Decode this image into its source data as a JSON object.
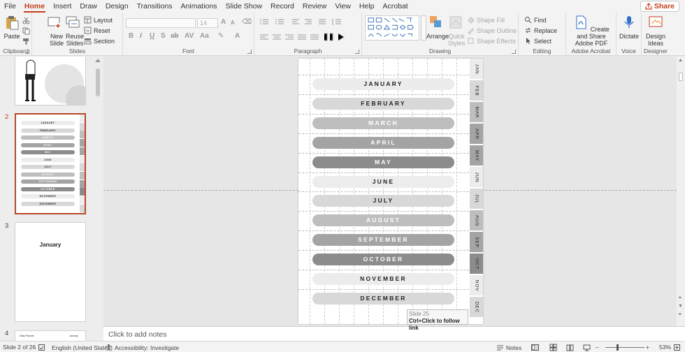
{
  "menu": {
    "tabs": [
      "File",
      "Home",
      "Insert",
      "Draw",
      "Design",
      "Transitions",
      "Animations",
      "Slide Show",
      "Record",
      "Review",
      "View",
      "Help",
      "Acrobat"
    ],
    "active_index": 1,
    "share_label": "Share"
  },
  "ribbon": {
    "clipboard": {
      "label": "Clipboard",
      "paste": "Paste"
    },
    "slides": {
      "label": "Slides",
      "new_slide": "New Slide",
      "reuse_slides": "Reuse Slides",
      "layout": "Layout",
      "reset": "Reset",
      "section": "Section"
    },
    "font": {
      "label": "Font",
      "size": "14"
    },
    "paragraph": {
      "label": "Paragraph"
    },
    "drawing": {
      "label": "Drawing",
      "arrange": "Arrange",
      "quick_styles": "Quick Styles",
      "shape_fill": "Shape Fill",
      "shape_outline": "Shape Outline",
      "shape_effects": "Shape Effects"
    },
    "editing": {
      "label": "Editing",
      "find": "Find",
      "replace": "Replace",
      "select": "Select"
    },
    "acrobat": {
      "label": "Adobe Acrobat",
      "create_share": "Create and Share Adobe PDF"
    },
    "voice": {
      "label": "Voice",
      "dictate": "Dictate"
    },
    "designer": {
      "label": "Designer",
      "design_ideas": "Design Ideas"
    }
  },
  "thumbnails": {
    "slide2_number": "2",
    "slide3_number": "3",
    "slide3_title": "January",
    "slide4_number": "4",
    "slide4_title": "Daily Planner",
    "slide4_right": "January"
  },
  "slide": {
    "months": [
      "JANUARY",
      "FEBRUARY",
      "MARCH",
      "APRIL",
      "MAY",
      "JUNE",
      "JULY",
      "AUGUST",
      "SEPTEMBER",
      "OCTOBER",
      "NOVEMBER",
      "DECEMBER"
    ],
    "tabs": [
      "JAN",
      "FEB",
      "MAR",
      "APR",
      "MAY",
      "JUN",
      "JUL",
      "AUG",
      "SEP",
      "OCT",
      "NOV",
      "DEC"
    ],
    "colors": {
      "light": "#ececec",
      "light_mid": "#d8d8d8",
      "mid": "#bebebe",
      "dark_mid": "#a4a4a4",
      "dark": "#8c8c8c",
      "text_dark": "#222222",
      "text_light": "#ffffff"
    }
  },
  "tooltip": {
    "line1": "Slide 25",
    "line2": "Ctrl+Click to follow link"
  },
  "notes": {
    "placeholder": "Click to add notes"
  },
  "status": {
    "slide_count": "Slide 2 of 26",
    "language": "English (United States)",
    "accessibility": "Accessibility: Investigate",
    "notes": "Notes",
    "zoom": "53%"
  }
}
